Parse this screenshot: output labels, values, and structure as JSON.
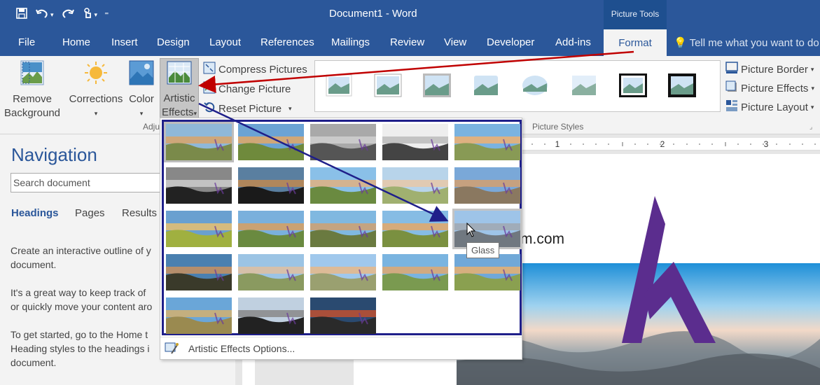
{
  "window": {
    "title": "Document1 - Word",
    "contextual_tab_group": "Picture Tools"
  },
  "qat": {
    "save_icon": "save-icon",
    "undo_icon": "undo-icon",
    "redo_icon": "redo-icon",
    "touch_icon": "touch-mode-icon",
    "customize_icon": "customize-qat-icon"
  },
  "tabs": [
    {
      "label": "File"
    },
    {
      "label": "Home"
    },
    {
      "label": "Insert"
    },
    {
      "label": "Design"
    },
    {
      "label": "Layout"
    },
    {
      "label": "References"
    },
    {
      "label": "Mailings"
    },
    {
      "label": "Review"
    },
    {
      "label": "View"
    },
    {
      "label": "Developer"
    },
    {
      "label": "Add-ins"
    },
    {
      "label": "Format"
    }
  ],
  "tell_me": "Tell me what you want to do",
  "ribbon": {
    "remove_background": [
      "Remove",
      "Background"
    ],
    "corrections": "Corrections",
    "color": "Color",
    "artistic_effects": [
      "Artistic",
      "Effects"
    ],
    "compress_pictures": "Compress Pictures",
    "change_picture": "Change Picture",
    "reset_picture": "Reset Picture",
    "adjust_group": "Adju",
    "picture_styles_group": "Picture Styles",
    "picture_border": "Picture Border",
    "picture_effects": "Picture Effects",
    "picture_layout": "Picture Layout"
  },
  "navigation": {
    "title": "Navigation",
    "search_placeholder": "Search document",
    "tabs": [
      "Headings",
      "Pages",
      "Results"
    ],
    "paragraphs": [
      [
        "Create an interactive outline of y",
        "document."
      ],
      [
        "It's a great way to keep track of",
        "or quickly move your content aro"
      ],
      [
        "To get started, go to the Home t",
        "Heading styles to the headings i",
        "document."
      ]
    ]
  },
  "ruler": {
    "labels": [
      "1",
      "2",
      "3"
    ]
  },
  "document": {
    "text_fragment": "m.com"
  },
  "gallery": {
    "footer_label": "Artistic Effects Options...",
    "footer_icon": "artistic-effects-options-icon",
    "tooltip": "Glass",
    "effects_count_rows": [
      5,
      5,
      5,
      5,
      3
    ]
  },
  "colors": {
    "accent": "#2b579a",
    "arrow_red": "#c00000",
    "arrow_blue": "#1f1f8a",
    "logo_purple": "#5b2d8e"
  }
}
